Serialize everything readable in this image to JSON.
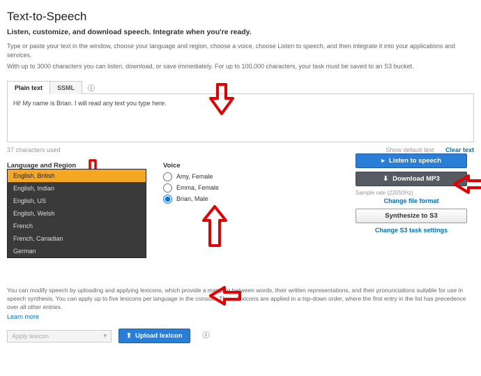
{
  "header": {
    "title": "Text-to-Speech",
    "lead": "Listen, customize, and download speech. Integrate when you're ready.",
    "sub1": "Type or paste your text in the window, choose your language and region, choose a voice, choose Listen to speech, and then integrate it into your applications and services.",
    "sub2": "With up to 3000 characters you can listen, download, or save immediately. For up to 100,000 characters, your task must be saved to an S3 bucket."
  },
  "tabs": {
    "plain": "Plain text",
    "ssml": "SSML"
  },
  "editor": {
    "text": "Hi! My name is Brian. I will read any text you type here.",
    "char_used": "37 characters used",
    "show_default": "Show default text",
    "clear": "Clear text"
  },
  "lang": {
    "label": "Language and Region",
    "selected": "English, British",
    "options": [
      "English, British",
      "English, Indian",
      "English, US",
      "English, Welsh",
      "French",
      "French, Canadian",
      "German"
    ]
  },
  "voice": {
    "label": "Voice",
    "options": [
      {
        "name": "Amy, Female",
        "selected": false
      },
      {
        "name": "Emma, Female",
        "selected": false
      },
      {
        "name": "Brian, Male",
        "selected": true
      }
    ]
  },
  "actions": {
    "listen": "Listen to speech",
    "download": "Download MP3",
    "sample": "Sample rate (22050Hz)",
    "change_format": "Change file format",
    "synth": "Synthesize to S3",
    "change_s3": "Change S3 task settings"
  },
  "lexicon": {
    "body": "You can modify speech by uploading and applying lexicons, which provide a mapping between words, their written representations, and their pronunciations suitable for use in speech synthesis. You can apply up to five lexicons per language in the console. These lexicons are applied in a top-down order, where the first entry in the list has precedence over all other entries.",
    "learn": "Learn more",
    "apply_placeholder": "Apply lexicon",
    "upload": "Upload lexicon"
  }
}
